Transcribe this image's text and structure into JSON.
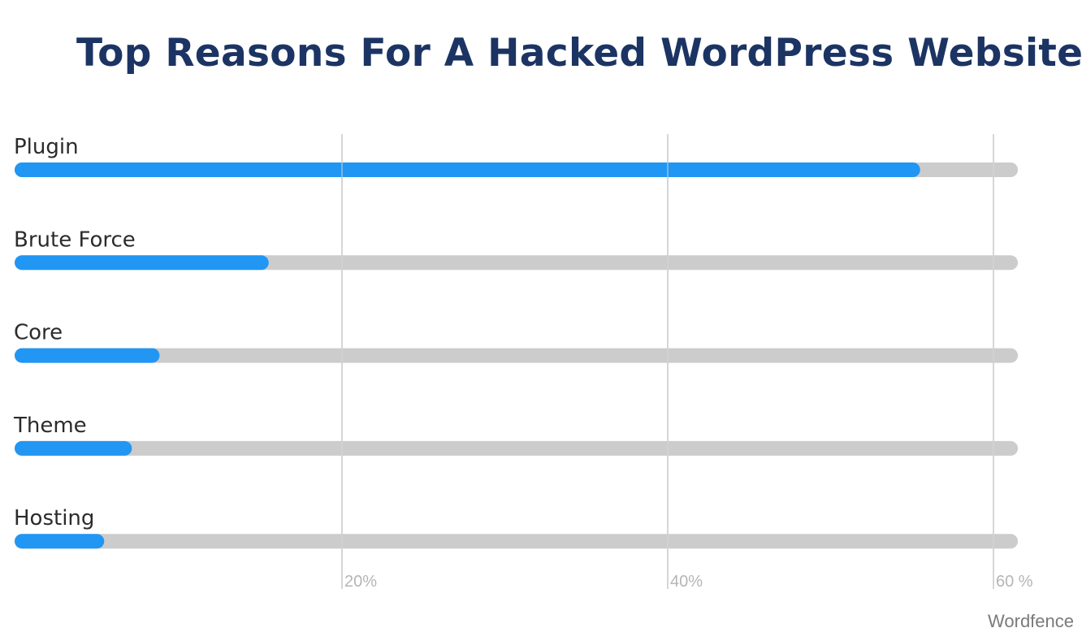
{
  "chart_data": {
    "type": "bar",
    "orientation": "horizontal",
    "title": "Top Reasons For A Hacked WordPress Website",
    "categories": [
      "Plugin",
      "Brute Force",
      "Core",
      "Theme",
      "Hosting"
    ],
    "values": [
      55.5,
      15.5,
      8.8,
      7.1,
      5.4
    ],
    "unit": "%",
    "track_max": 61.5,
    "xlim": [
      0,
      61.5
    ],
    "ticks": [
      {
        "value": 20,
        "label": "20%"
      },
      {
        "value": 40,
        "label": "40%"
      },
      {
        "value": 60,
        "label": "60 %"
      }
    ],
    "grid": true,
    "xlabel": "",
    "ylabel": "",
    "source": "Wordfence",
    "colors": {
      "bar": "#2196f3",
      "track": "#cccccc",
      "grid": "#d6d6d6",
      "title": "#1c3463",
      "label": "#2b2b2b",
      "tick": "#b5b5b5"
    }
  }
}
